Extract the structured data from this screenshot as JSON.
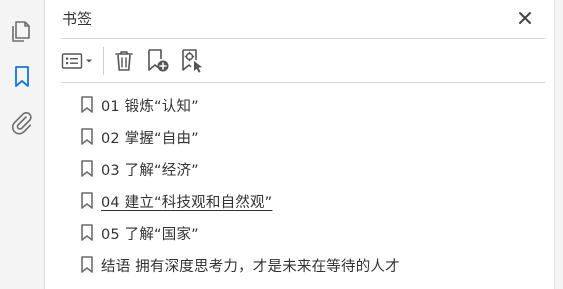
{
  "rail": {
    "items": [
      {
        "name": "pages",
        "icon": "pages-icon"
      },
      {
        "name": "bookmarks",
        "icon": "bookmark-icon",
        "active": true
      },
      {
        "name": "attachments",
        "icon": "paperclip-icon"
      }
    ]
  },
  "panel": {
    "title": "书签",
    "close_icon": "close-icon"
  },
  "toolbar": {
    "buttons": [
      "options-menu-icon",
      "trash-icon",
      "add-bookmark-icon",
      "bookmark-settings-icon"
    ]
  },
  "bookmarks": [
    {
      "label": "01  锻炼“认知”",
      "underline": false
    },
    {
      "label": "02  掌握“自由”",
      "underline": false
    },
    {
      "label": "03  了解“经济”",
      "underline": false
    },
    {
      "label": "04  建立“科技观和自然观”",
      "underline": true
    },
    {
      "label": "05  了解“国家”",
      "underline": false
    },
    {
      "label": "结语  拥有深度思考力，才是未来在等待的人才",
      "underline": false
    }
  ],
  "colors": {
    "accent": "#1473e6",
    "icon": "#6e6e6e",
    "text": "#333333",
    "divider": "#d9d9d9"
  }
}
